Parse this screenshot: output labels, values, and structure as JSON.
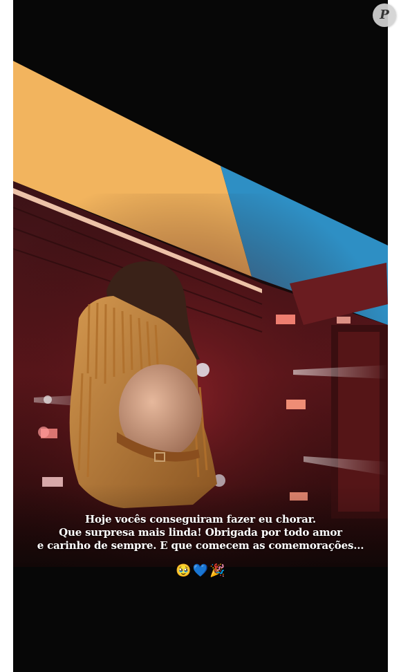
{
  "story": {
    "caption_lines": [
      "Hoje vocês conseguiram fazer eu chorar.",
      "Que surpresa mais linda! Obrigada por todo amor",
      "e carinho de sempre. E que comecem as comemorações..."
    ],
    "emojis": [
      "🥹",
      "💙",
      "🎉"
    ]
  },
  "badge": {
    "letter": "P"
  },
  "colors": {
    "screen_yellow": "#f2b45e",
    "screen_blue": "#2e8fc4",
    "stage_red": "#7a1f24",
    "background": "#070707"
  }
}
